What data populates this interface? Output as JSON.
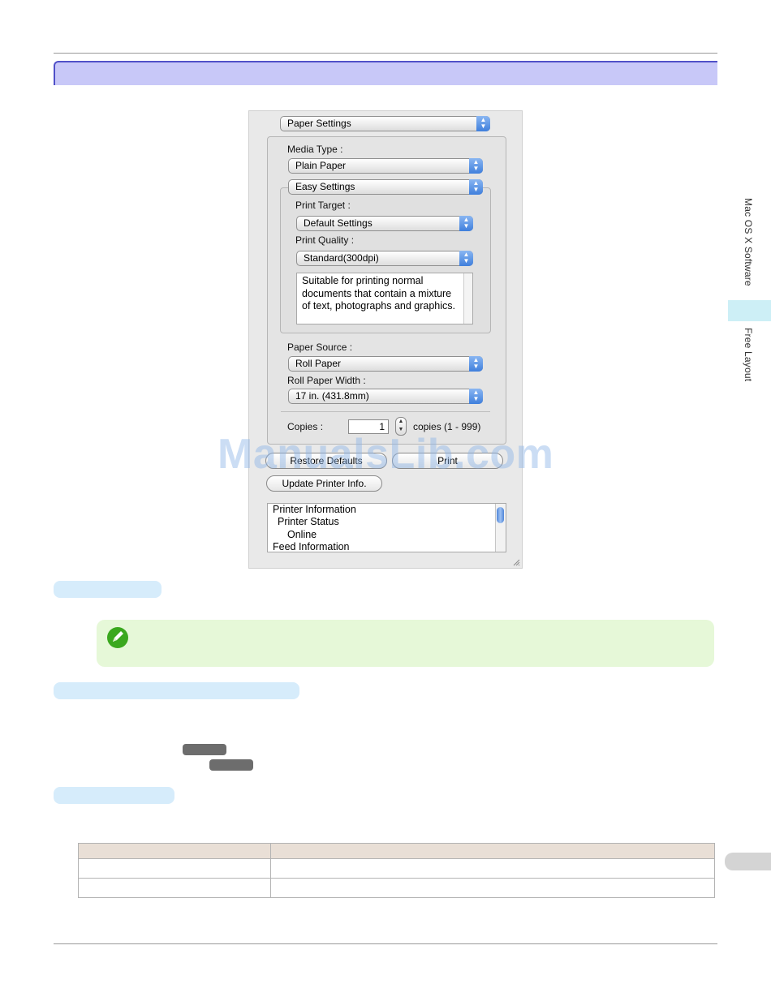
{
  "dialog": {
    "main_popup": "Paper Settings",
    "media_type": {
      "label": "Media Type :",
      "value": "Plain Paper"
    },
    "mode_popup": "Easy Settings",
    "print_target": {
      "label": "Print Target :",
      "value": "Default Settings"
    },
    "print_quality": {
      "label": "Print Quality :",
      "value": "Standard(300dpi)"
    },
    "description": "Suitable for printing normal documents that contain a mixture of text, photographs and graphics.",
    "paper_source": {
      "label": "Paper Source :",
      "value": "Roll Paper"
    },
    "roll_width": {
      "label": "Roll Paper Width :",
      "value": "17 in. (431.8mm)"
    },
    "copies": {
      "label": "Copies :",
      "value": "1",
      "range": "copies (1 - 999)"
    },
    "restore_button": "Restore Defaults",
    "print_button": "Print",
    "update_button": "Update Printer Info.",
    "info_list": [
      "Printer Information",
      "Printer Status",
      "Online",
      "Feed Information"
    ]
  },
  "watermark": "ManualsLib.com",
  "side_nav": {
    "section": "Mac OS X Software",
    "subsection": "Free Layout"
  },
  "colors": {
    "title_bar": "#c8c8f8",
    "title_border": "#5050c8",
    "heading_pill": "#d6ecfb",
    "note_box": "#e6f8d8",
    "note_icon": "#3aa81e",
    "table_header": "#e9dfd6",
    "watermark": "#8cb4e6"
  },
  "icons": {
    "note": "pencil-check-icon",
    "popup_arrows": "up-down-arrows-icon",
    "resize": "resize-grip-icon"
  }
}
